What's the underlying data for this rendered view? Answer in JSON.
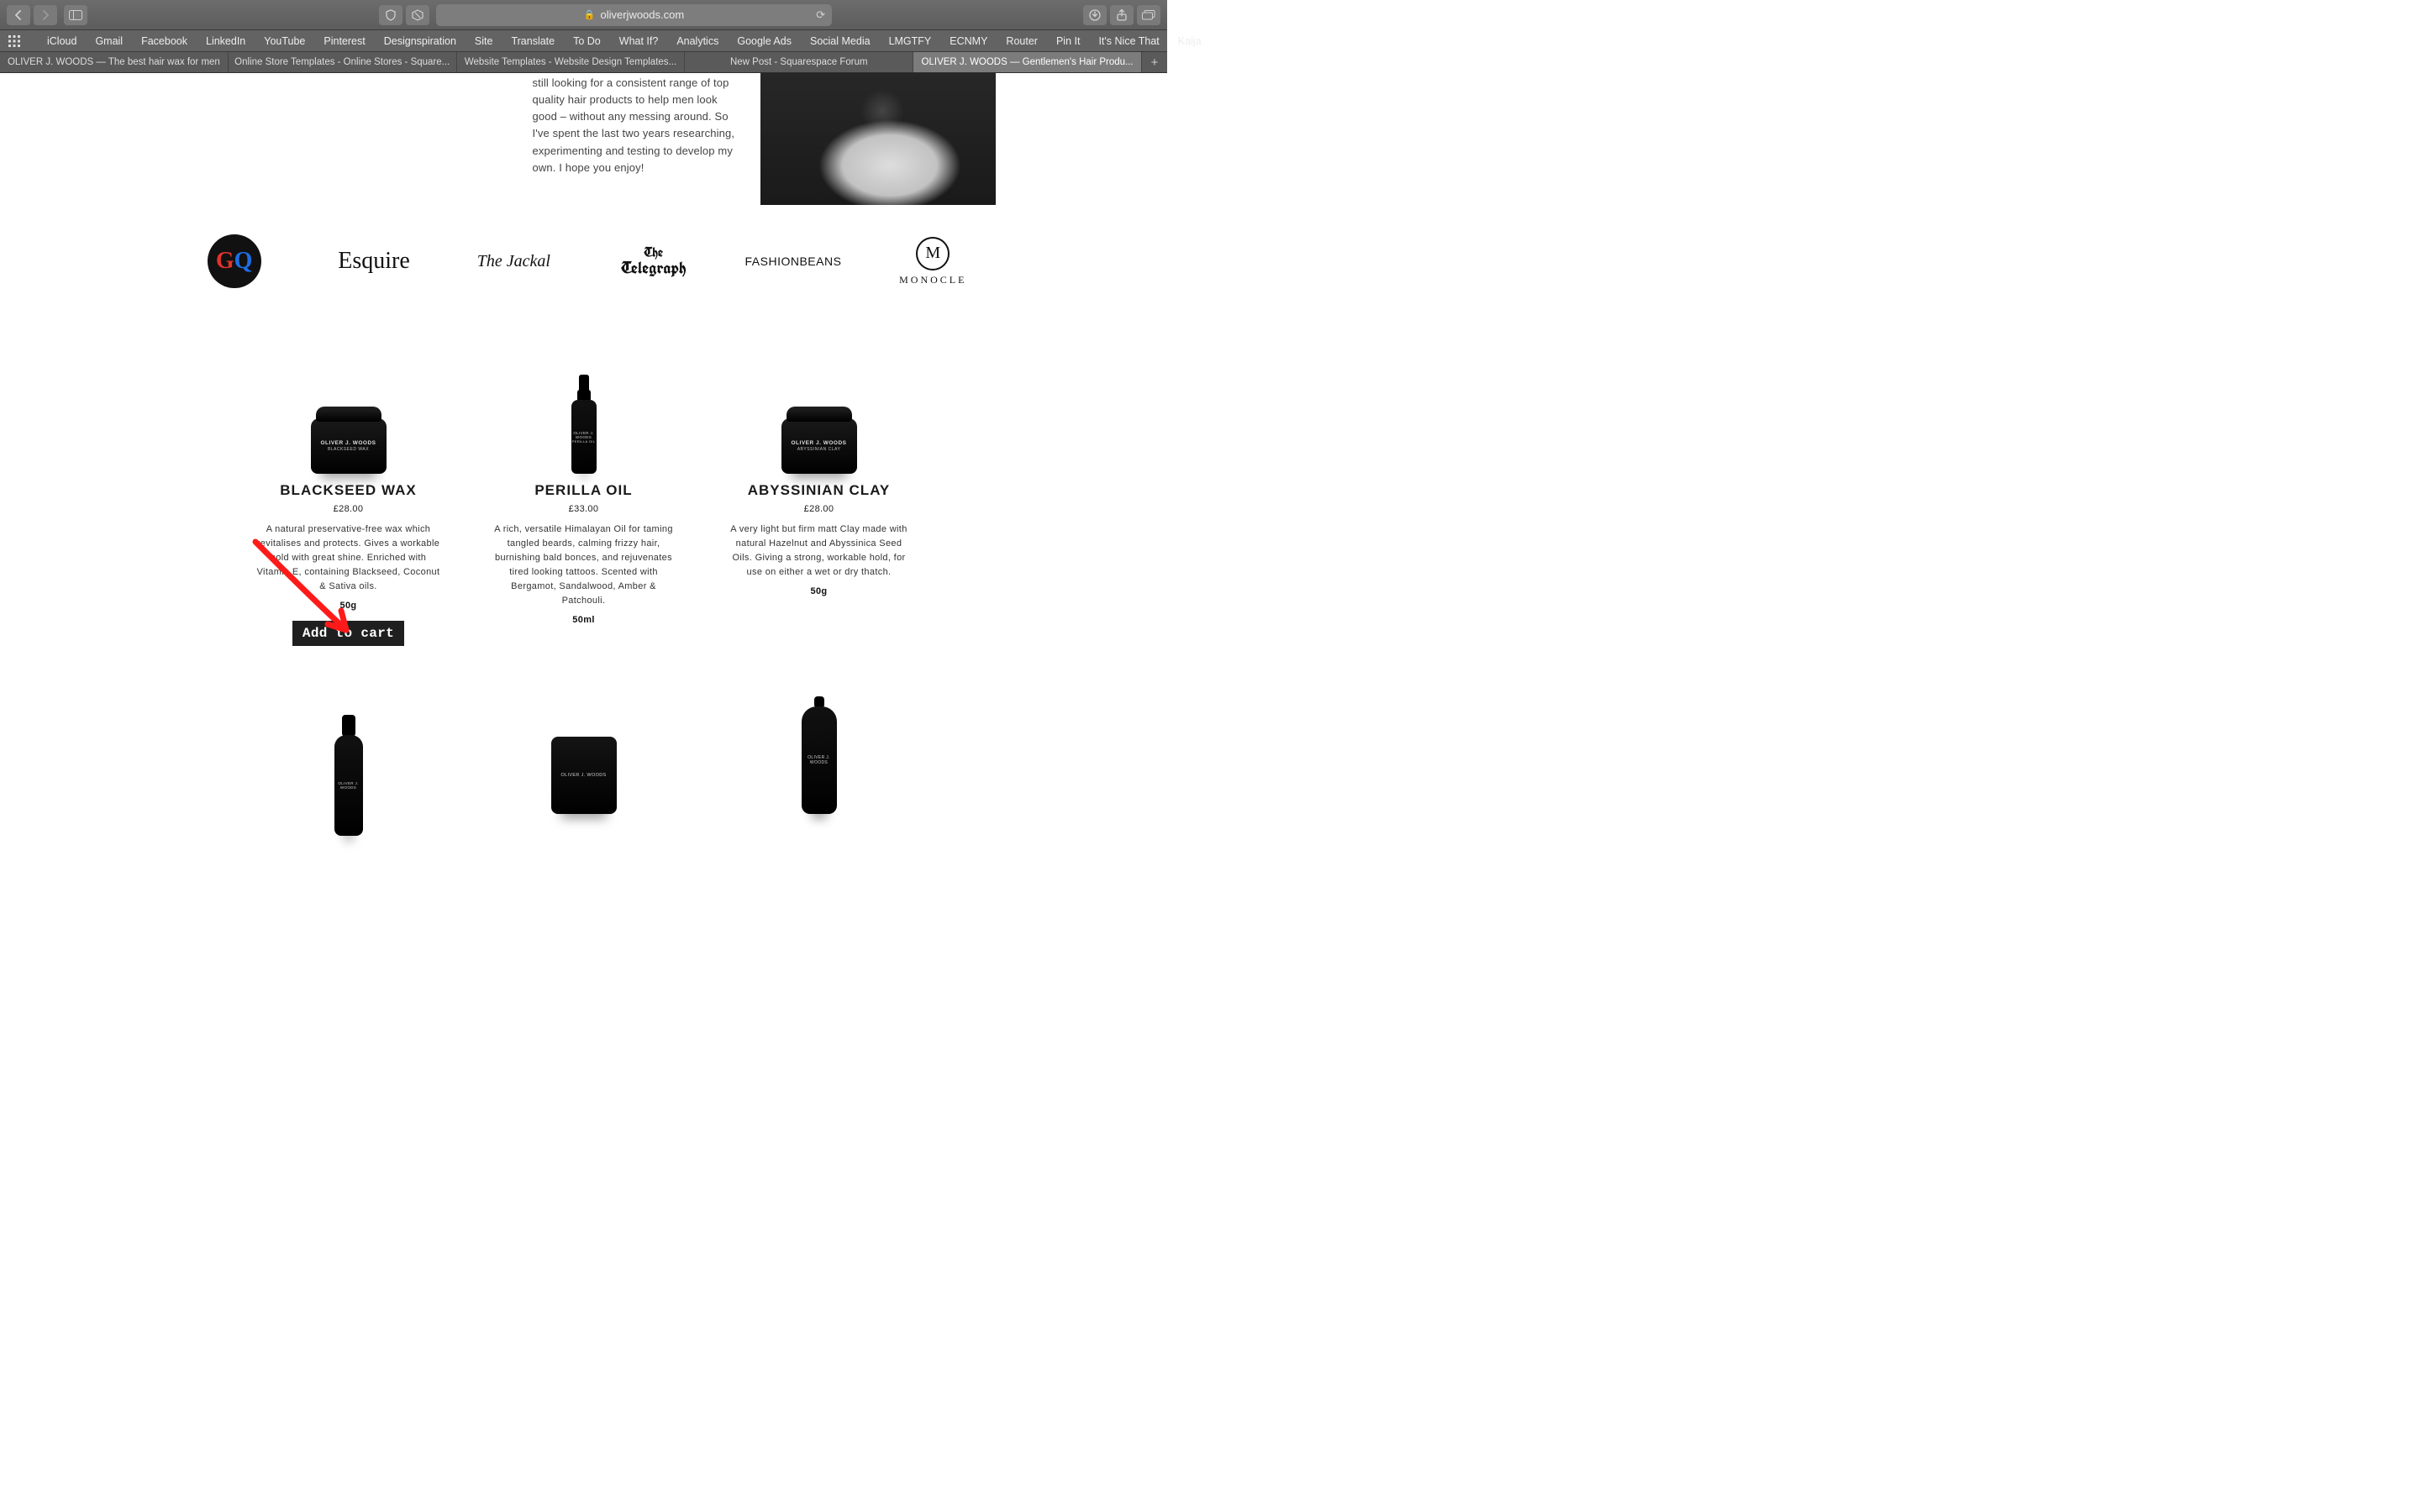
{
  "browser": {
    "url_display": "oliverjwoods.com",
    "lock": "🔒",
    "favorites": [
      "iCloud",
      "Gmail",
      "Facebook",
      "LinkedIn",
      "YouTube",
      "Pinterest",
      "Designspiration",
      "Site",
      "Translate",
      "To Do",
      "What If?",
      "Analytics",
      "Google Ads",
      "Social Media",
      "LMGTFY",
      "ECNMY",
      "Router",
      "Pin It",
      "It's Nice That",
      "Kaija"
    ],
    "tabs": [
      {
        "label": "OLIVER J. WOODS — The best hair wax for men"
      },
      {
        "label": "Online Store Templates - Online Stores - Square..."
      },
      {
        "label": "Website Templates - Website Design Templates..."
      },
      {
        "label": "New Post - Squarespace Forum"
      },
      {
        "label": "OLIVER J. WOODS — Gentlemen's Hair Produ..."
      }
    ],
    "active_tab_index": 4
  },
  "intro_paragraph": "still looking for a consistent range of top quality hair products to help men look good – without any messing around. So I've spent the last two years researching, experimenting and testing to develop my own. I hope you enjoy!",
  "press": {
    "gq": "GQ",
    "esquire": "Esquire",
    "jackal": "The Jackal",
    "telegraph_top": "The",
    "telegraph_bottom": "Telegraph",
    "fashionbeans": "FASHIONBEANS",
    "monocle_m": "M",
    "monocle": "MONOCLE"
  },
  "products": [
    {
      "title": "BLACKSEED WAX",
      "price": "£28.00",
      "desc": "A natural preservative-free  wax which revitalises and protects. Gives a workable hold with great shine. Enriched with Vitamin E, containing Blackseed, Coconut & Sativa oils.",
      "size": "50g",
      "jar_sub": "BLACKSEED WAX",
      "add_label": "Add to cart"
    },
    {
      "title": "PERILLA OIL",
      "price": "£33.00",
      "desc": "A rich, versatile Himalayan Oil for taming tangled beards, calming frizzy hair, burnishing bald bonces, and rejuvenates tired looking tattoos. Scented with Bergamot, Sandalwood, Amber & Patchouli.",
      "size": "50ml",
      "jar_sub": "PERILLA OIL"
    },
    {
      "title": "ABYSSINIAN CLAY",
      "price": "£28.00",
      "desc": "A very light but firm matt Clay made with natural Hazelnut and Abyssinica Seed Oils. Giving a strong, workable hold, for use on either a wet or dry thatch.",
      "size": "50g",
      "jar_sub": "ABYSSINIAN CLAY"
    }
  ],
  "brand_label": "OLIVER J. WOODS",
  "annotation": {
    "color": "#ff1a1a"
  }
}
